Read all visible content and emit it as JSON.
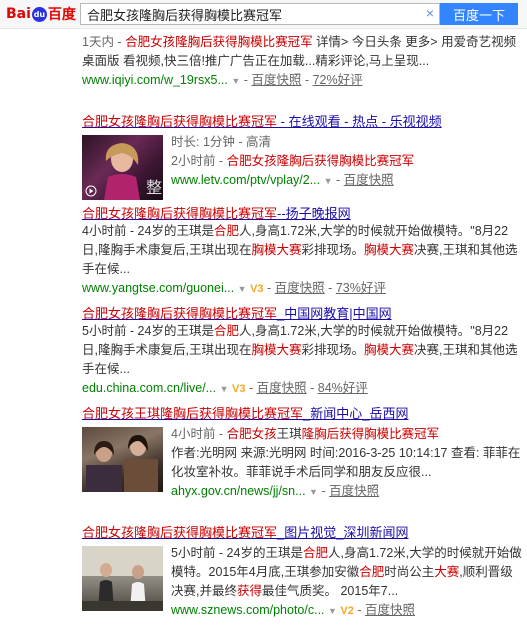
{
  "header": {
    "logo": {
      "left": "Bai",
      "paw": "du",
      "right": "百度"
    },
    "search_value": "合肥女孩隆胸后获得胸模比赛冠军",
    "search_button": "百度一下"
  },
  "result1": {
    "snippet_a": "1天内 - ",
    "snippet_em": "合肥女孩隆胸后获得胸模比赛冠军",
    "snippet_b": " 详情> 今日头条 更多> 用爱奇艺视频桌面版 看视频,快三倍!推广广告正在加载...精彩评论,马上呈现...",
    "url": "www.iqiyi.com/w_19rsx5...",
    "snapshot": "百度快照",
    "rating": "72%好评"
  },
  "result2": {
    "title_em": "合肥女孩隆胸后获得胸模比赛冠军",
    "title_rest": " - 在线观看 - 热点 - 乐视视频",
    "duration": "时长: 1分钟 - 高清",
    "time": "2小时前 - ",
    "desc_em": "合肥女孩隆胸后获得胸模比赛冠军",
    "url": "www.letv.com/ptv/vplay/2...",
    "snapshot": "百度快照"
  },
  "result3": {
    "title_em": "合肥女孩隆胸后获得胸模比赛冠军",
    "title_rest": "--扬子晚报网",
    "snippet": [
      {
        "t": "4小时前 - 24岁的王琪是",
        "e": false
      },
      {
        "t": "合肥",
        "e": true
      },
      {
        "t": "人,身高1.72米,大学的时候就开始做模特。\"8月22日,隆胸手术康复后,王琪出现在",
        "e": false
      },
      {
        "t": "胸模大赛",
        "e": true
      },
      {
        "t": "彩排现场。",
        "e": false
      },
      {
        "t": "胸模大赛",
        "e": true
      },
      {
        "t": "决赛,王琪和其他选手在候...",
        "e": false
      }
    ],
    "url": "www.yangtse.com/guonei...",
    "badge": "V3",
    "snapshot": "百度快照",
    "rating": "73%好评"
  },
  "result4": {
    "title_em": "合肥女孩隆胸后获得胸模比赛冠军",
    "title_rest": "_中国网教育|中国网",
    "snippet": [
      {
        "t": "5小时前 - 24岁的王琪是",
        "e": false
      },
      {
        "t": "合肥",
        "e": true
      },
      {
        "t": "人,身高1.72米,大学的时候就开始做模特。\"8月22日,隆胸手术康复后,王琪出现在",
        "e": false
      },
      {
        "t": "胸模大赛",
        "e": true
      },
      {
        "t": "彩排现场。",
        "e": false
      },
      {
        "t": "胸模大赛",
        "e": true
      },
      {
        "t": "决赛,王琪和其他选手在候...",
        "e": false
      }
    ],
    "url": "edu.china.com.cn/live/...",
    "badge": "V3",
    "snapshot": "百度快照",
    "rating": "84%好评"
  },
  "result5": {
    "title_em": "合肥女孩王琪隆胸后获得胸模比赛冠军",
    "title_rest": "_新闻中心_岳西网",
    "time": "4小时前 - ",
    "desc_em": "合肥女孩",
    "desc_mid": "王琪",
    "desc_em2": "隆胸后获得胸模比赛冠军",
    "line2": "作者:光明网 来源:光明网 时间:2016-3-25 10:14:17 查看: 菲菲在化妆室补妆。菲菲说手术后同学和朋友反应很...",
    "url": "ahyx.gov.cn/news/jj/sn...",
    "snapshot": "百度快照"
  },
  "result6": {
    "title_em": "合肥女孩隆胸后获得胸模比赛冠军",
    "title_rest": "_图片视觉_深圳新闻网",
    "snippet": [
      {
        "t": "5小时前 - 24岁的王琪是",
        "e": false
      },
      {
        "t": "合肥",
        "e": true
      },
      {
        "t": "人,身高1.72米,大学的时候就开始做模特。2015年4月底,王琪参加安徽",
        "e": false
      },
      {
        "t": "合肥",
        "e": true
      },
      {
        "t": "时尚公主",
        "e": false
      },
      {
        "t": "大赛",
        "e": true
      },
      {
        "t": ",顺利晋级决赛,并最终",
        "e": false
      },
      {
        "t": "获得",
        "e": true
      },
      {
        "t": "最佳气质奖。 2015年7...",
        "e": false
      }
    ],
    "url": "www.sznews.com/photo/c...",
    "badge": "V2",
    "snapshot": "百度快照"
  },
  "colors": {
    "link": "#1a0dab",
    "highlight": "#c00",
    "url": "#008000",
    "button": "#3385ff"
  }
}
